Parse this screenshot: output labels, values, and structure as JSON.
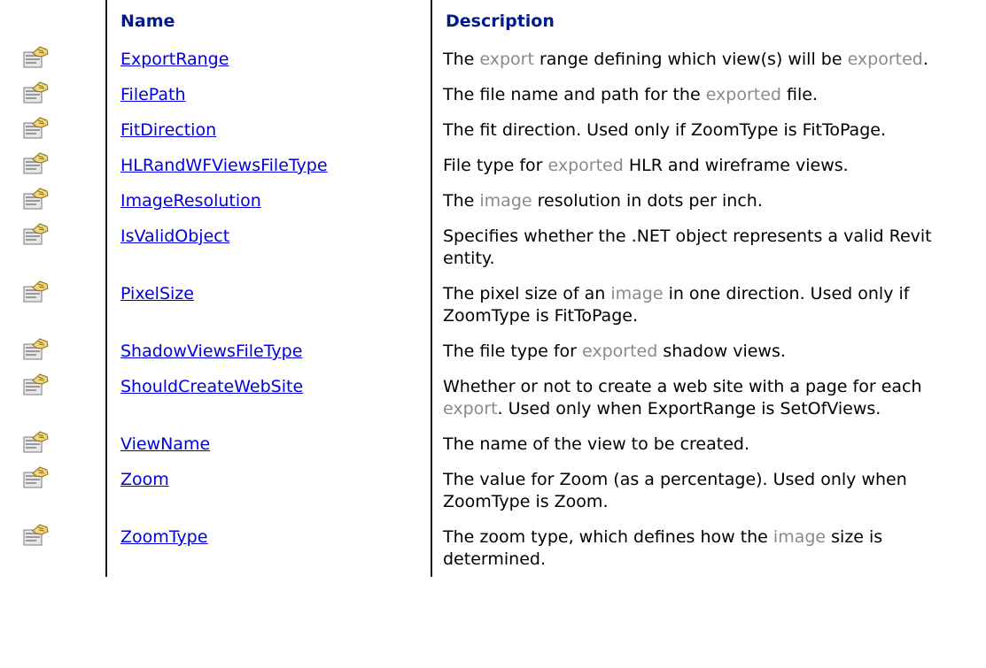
{
  "header": {
    "name": "Name",
    "description": "Description"
  },
  "rows": [
    {
      "name": "ExportRange",
      "desc": [
        [
          "The ",
          false
        ],
        [
          "export",
          true
        ],
        [
          " range defining which view(s) will be ",
          false
        ],
        [
          "exported",
          true
        ],
        [
          ".",
          false
        ]
      ]
    },
    {
      "name": "FilePath",
      "desc": [
        [
          "The file name and path for the ",
          false
        ],
        [
          "exported",
          true
        ],
        [
          " file.",
          false
        ]
      ]
    },
    {
      "name": "FitDirection",
      "desc": [
        [
          "The fit direction. Used only if ZoomType is FitToPage.",
          false
        ]
      ]
    },
    {
      "name": "HLRandWFViewsFileType",
      "desc": [
        [
          "File type for ",
          false
        ],
        [
          "exported",
          true
        ],
        [
          " HLR and wireframe views.",
          false
        ]
      ]
    },
    {
      "name": "ImageResolution",
      "desc": [
        [
          "The ",
          false
        ],
        [
          "image",
          true
        ],
        [
          " resolution in dots per inch.",
          false
        ]
      ]
    },
    {
      "name": "IsValidObject",
      "desc": [
        [
          "Specifies whether the .NET object represents a valid Revit entity.",
          false
        ]
      ]
    },
    {
      "name": "PixelSize",
      "desc": [
        [
          "The pixel size of an ",
          false
        ],
        [
          "image",
          true
        ],
        [
          " in one direction. Used only if ZoomType is FitToPage.",
          false
        ]
      ]
    },
    {
      "name": "ShadowViewsFileType",
      "desc": [
        [
          "The file type for ",
          false
        ],
        [
          "exported",
          true
        ],
        [
          " shadow views.",
          false
        ]
      ]
    },
    {
      "name": "ShouldCreateWebSite",
      "desc": [
        [
          "Whether or not to create a web site with a page for each ",
          false
        ],
        [
          "export",
          true
        ],
        [
          ". Used only when ExportRange is SetOfViews.",
          false
        ]
      ]
    },
    {
      "name": "ViewName",
      "desc": [
        [
          "The name of the view to be created.",
          false
        ]
      ]
    },
    {
      "name": "Zoom",
      "desc": [
        [
          "The value for Zoom (as a percentage). Used only when ZoomType is Zoom.",
          false
        ]
      ]
    },
    {
      "name": "ZoomType",
      "desc": [
        [
          "The zoom type, which defines how the ",
          false
        ],
        [
          "image",
          true
        ],
        [
          " size is determined.",
          false
        ]
      ]
    }
  ],
  "icon": "property-icon",
  "colors": {
    "header_text": "#001c8c",
    "link": "#0000e0",
    "highlight": "#8a8a8a"
  }
}
